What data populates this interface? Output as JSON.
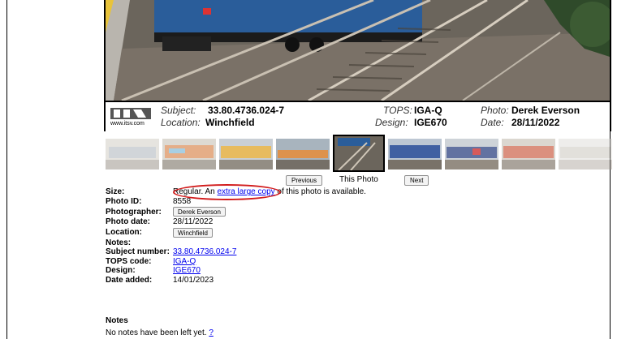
{
  "caption": {
    "logo_text": "ITSV",
    "logo_url": "www.itsv.com",
    "subject_label": "Subject:",
    "subject_value": "33.80.4736.024-7",
    "location_label": "Location:",
    "location_value": "Winchfield",
    "tops_label": "TOPS:",
    "tops_value": "IGA-Q",
    "design_label": "Design:",
    "design_value": "IGE670",
    "photo_label": "Photo:",
    "photo_value": "Derek Everson",
    "date_label": "Date:",
    "date_value": "28/11/2022"
  },
  "nav": {
    "previous": "Previous",
    "this_photo": "This Photo",
    "next": "Next"
  },
  "info": {
    "size_label": "Size:",
    "size_pre": "Regular. An ",
    "size_link": "extra large copy",
    "size_post": " of this photo is available.",
    "photo_id_label": "Photo ID:",
    "photo_id": "8558",
    "photographer_label": "Photographer:",
    "photographer": "Derek Everson",
    "photo_date_label": "Photo date:",
    "photo_date": "28/11/2022",
    "location_label": "Location:",
    "location": "Winchfield",
    "notes_label": "Notes:",
    "subject_number_label": "Subject number:",
    "subject_number": "33.80.4736.024-7",
    "tops_code_label": "TOPS code:",
    "tops_code": "IGA-Q",
    "design_label": "Design:",
    "design": "IGE670",
    "date_added_label": "Date added:",
    "date_added": "14/01/2023"
  },
  "notes": {
    "title": "Notes",
    "text": "No notes have been left yet.",
    "help": "?"
  },
  "colors": {
    "link": "#0000ee",
    "highlight_circle": "#d21b1b"
  }
}
